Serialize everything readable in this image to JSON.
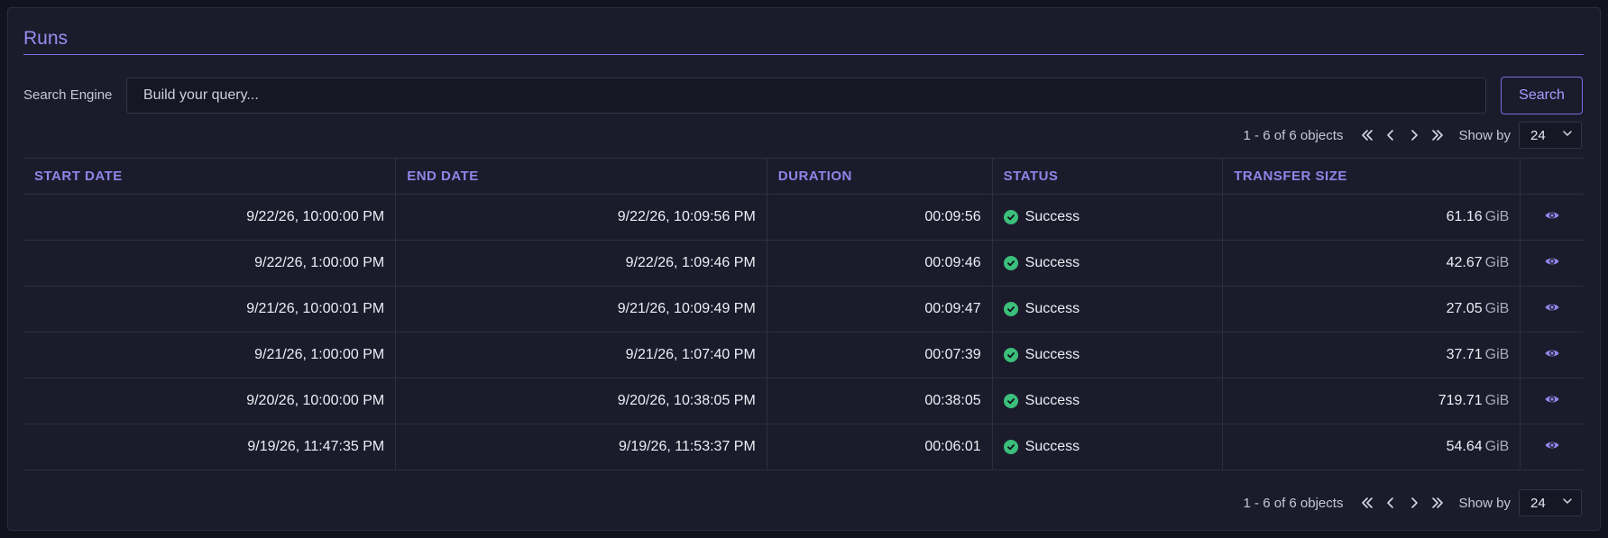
{
  "header": {
    "title": "Runs"
  },
  "search": {
    "label": "Search Engine",
    "placeholder": "Build your query...",
    "button_label": "Search"
  },
  "pagination": {
    "count_text": "1 - 6 of 6 objects",
    "show_by_label": "Show by",
    "show_by_value": "24",
    "icons": [
      "first-page-icon",
      "previous-page-icon",
      "next-page-icon",
      "last-page-icon"
    ]
  },
  "table": {
    "columns": [
      "START DATE",
      "END DATE",
      "DURATION",
      "STATUS",
      "TRANSFER SIZE"
    ],
    "rows": [
      {
        "start": "9/22/26, 10:00:00 PM",
        "end": "9/22/26, 10:09:56 PM",
        "duration": "00:09:56",
        "status": "Success",
        "size": "61.16",
        "unit": "GiB"
      },
      {
        "start": "9/22/26, 1:00:00 PM",
        "end": "9/22/26, 1:09:46 PM",
        "duration": "00:09:46",
        "status": "Success",
        "size": "42.67",
        "unit": "GiB"
      },
      {
        "start": "9/21/26, 10:00:01 PM",
        "end": "9/21/26, 10:09:49 PM",
        "duration": "00:09:47",
        "status": "Success",
        "size": "27.05",
        "unit": "GiB"
      },
      {
        "start": "9/21/26, 1:00:00 PM",
        "end": "9/21/26, 1:07:40 PM",
        "duration": "00:07:39",
        "status": "Success",
        "size": "37.71",
        "unit": "GiB"
      },
      {
        "start": "9/20/26, 10:00:00 PM",
        "end": "9/20/26, 10:38:05 PM",
        "duration": "00:38:05",
        "status": "Success",
        "size": "719.71",
        "unit": "GiB"
      },
      {
        "start": "9/19/26, 11:47:35 PM",
        "end": "9/19/26, 11:53:37 PM",
        "duration": "00:06:01",
        "status": "Success",
        "size": "54.64",
        "unit": "GiB"
      }
    ]
  },
  "colors": {
    "accent": "#9b8cf0",
    "success": "#3bbf7a",
    "background": "#1b1b2c"
  }
}
